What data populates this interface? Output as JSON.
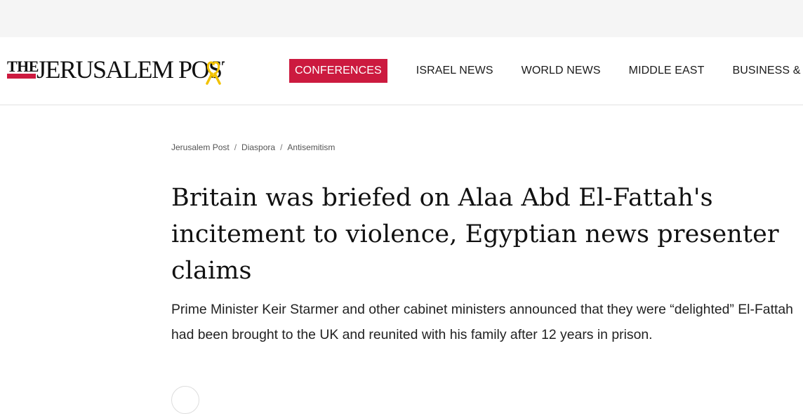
{
  "site": {
    "logo_text": "THE JERUSALEM POST",
    "logo_icon": "yellow-ribbon-icon",
    "brand_color": "#cc1a3f"
  },
  "nav": {
    "items": [
      {
        "label": "CONFERENCES",
        "active": true
      },
      {
        "label": "ISRAEL NEWS",
        "active": false
      },
      {
        "label": "WORLD NEWS",
        "active": false
      },
      {
        "label": "MIDDLE EAST",
        "active": false
      },
      {
        "label": "BUSINESS & INNO",
        "active": false
      }
    ]
  },
  "breadcrumb": [
    "Jerusalem Post",
    "Diaspora",
    "Antisemitism"
  ],
  "article": {
    "headline": "Britain was briefed on Alaa Abd El-Fattah's incitement to violence, Egyptian news presenter claims",
    "subheadline": "Prime Minister Keir Starmer and other cabinet ministers announced that they were “delighted” El-Fattah had been brought to the UK and reunited with his family after 12 years in prison."
  }
}
